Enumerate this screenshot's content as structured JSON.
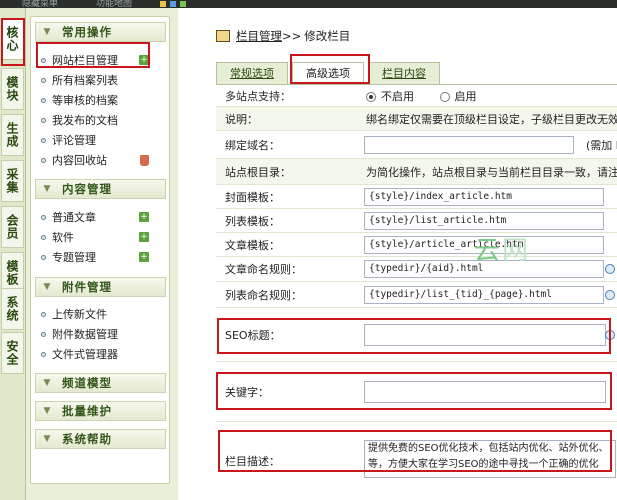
{
  "topbar": {
    "item1": "隐藏菜单",
    "item2": "功能地图"
  },
  "vtabs": [
    "核心",
    "模块",
    "生成",
    "采集",
    "会员",
    "模板",
    "系统",
    "安全"
  ],
  "sidebar": {
    "sections": [
      {
        "title": "常用操作",
        "items": [
          {
            "label": "网站栏目管理",
            "icon": "plus-icon"
          },
          {
            "label": "所有档案列表"
          },
          {
            "label": "等审核的档案"
          },
          {
            "label": "我发布的文档"
          },
          {
            "label": "评论管理"
          },
          {
            "label": "内容回收站",
            "icon": "trash-icon"
          }
        ]
      },
      {
        "title": "内容管理",
        "items": [
          {
            "label": "普通文章",
            "icon": "plus-icon"
          },
          {
            "label": "软件",
            "icon": "plus-icon"
          },
          {
            "label": "专题管理",
            "icon": "plus-icon"
          }
        ]
      },
      {
        "title": "附件管理",
        "items": [
          {
            "label": "上传新文件"
          },
          {
            "label": "附件数据管理"
          },
          {
            "label": "文件式管理器"
          }
        ]
      },
      {
        "title": "频道模型",
        "items": []
      },
      {
        "title": "批量维护",
        "items": []
      },
      {
        "title": "系统帮助",
        "items": []
      }
    ]
  },
  "breadcrumb": {
    "link": "栏目管理",
    "sep": ">>",
    "current": "修改栏目"
  },
  "tabs": [
    "常规选项",
    "高级选项",
    "栏目内容"
  ],
  "form": {
    "multisite": {
      "label": "多站点支持：",
      "opt_off": "不启用",
      "opt_on": "启用"
    },
    "note": {
      "label": "说明：",
      "text": "绑名绑定仅需要在顶级栏目设定，子级栏目更改无效"
    },
    "domain": {
      "label": "绑定域名：",
      "value": "",
      "hint": "(需加 h"
    },
    "root": {
      "label": "站点根目录：",
      "text": "为简化操作，站点根目录与当前栏目目录一致，请注"
    },
    "cover_tpl": {
      "label": "封面模板：",
      "value": "{style}/index_article.htm"
    },
    "list_tpl": {
      "label": "列表模板：",
      "value": "{style}/list_article.htm"
    },
    "article_tpl": {
      "label": "文章模板：",
      "value": "{style}/article_article.htm"
    },
    "article_rule": {
      "label": "文章命名规则：",
      "value": "{typedir}/{aid}.html"
    },
    "list_rule": {
      "label": "列表命名规则：",
      "value": "{typedir}/list_{tid}_{page}.html"
    },
    "seo_title": {
      "label": "SEO标题：",
      "value": ""
    },
    "keywords": {
      "label": "关键字：",
      "value": ""
    },
    "description": {
      "label": "栏目描述：",
      "value": "提供免费的SEO优化技术，包括站内优化、站外优化、等，方便大家在学习SEO的途中寻找一个正确的优化"
    }
  },
  "watermark": {
    "a": "云",
    "b": "网"
  }
}
